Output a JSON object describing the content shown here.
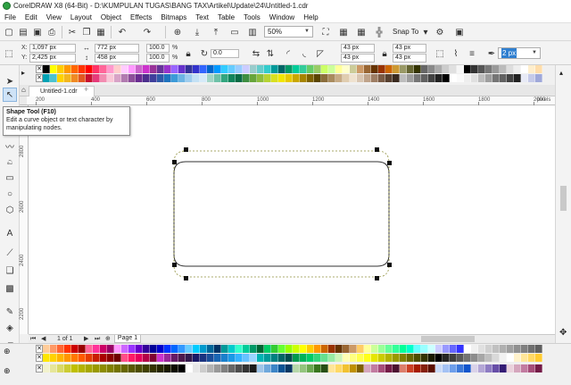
{
  "window": {
    "title": "CorelDRAW X8 (64-Bit) - D:\\KUMPULAN TUGAS\\BANG TAX\\Artikel\\Update\\24\\Untitled-1.cdr"
  },
  "menu": [
    "File",
    "Edit",
    "View",
    "Layout",
    "Object",
    "Effects",
    "Bitmaps",
    "Text",
    "Table",
    "Tools",
    "Window",
    "Help"
  ],
  "toolbar": {
    "zoom": "50%",
    "snap_label": "Snap To"
  },
  "property_bar": {
    "x_label": "X:",
    "x_value": "1,097 px",
    "y_label": "Y:",
    "y_value": "2,425 px",
    "width_value": "772 px",
    "height_value": "458 px",
    "scale_x": "100.0",
    "scale_y": "100.0",
    "pct": "%",
    "rotation": "0.0",
    "corner_tl": "43 px",
    "corner_tr": "43 px",
    "corner_bl": "43 px",
    "corner_br": "43 px",
    "outline_width": "2 px"
  },
  "document": {
    "tab_label": "Untitled-1.cdr",
    "page_counter": "1 of 1",
    "page_tab": "Page 1"
  },
  "ruler": {
    "h_labels": [
      "200",
      "400",
      "600",
      "800",
      "1000",
      "1200",
      "1400",
      "1600",
      "1800",
      "2000"
    ],
    "h_unit": "pixels",
    "v_labels": [
      "2800",
      "2600",
      "2400",
      "2200"
    ]
  },
  "tooltip": {
    "title": "Shape Tool (F10)",
    "description": "Edit a curve object or text character by manipulating nodes."
  },
  "colors": {
    "accent": "#2f7fd0",
    "palette_top_1": [
      "#ffffff",
      "#000000",
      "#ffff00",
      "#ffcc00",
      "#ff9900",
      "#ff6600",
      "#ff3300",
      "#ff0000",
      "#ff3366",
      "#ff6699",
      "#ff99cc",
      "#ffcccc",
      "#ffccff",
      "#ff99ff",
      "#cc66cc",
      "#cc33cc",
      "#993399",
      "#663399",
      "#9933cc",
      "#9966ff",
      "#6633cc",
      "#333399",
      "#3333cc",
      "#3366ff",
      "#0066cc",
      "#0099ff",
      "#33ccff",
      "#66ccff",
      "#99ccff",
      "#ccccff",
      "#99cccc",
      "#66cccc",
      "#33cccc",
      "#009999",
      "#006666",
      "#009966",
      "#00cc99",
      "#33cc99",
      "#66cc66",
      "#99cc66",
      "#ccff66",
      "#ccff99",
      "#ffff99",
      "#ffffcc",
      "#cccc99",
      "#cc9966",
      "#996633",
      "#663300",
      "#993300",
      "#cc6600",
      "#cc9933",
      "#999966",
      "#666633",
      "#333300",
      "#666666",
      "#888888",
      "#aaaaaa",
      "#cccccc",
      "#e0e0e0",
      "#f5f5f5",
      "#000000",
      "#333333",
      "#555555",
      "#777777",
      "#999999",
      "#bbbbbb",
      "#dddddd",
      "#eeeeee",
      "#ffffff",
      "#ffeecc",
      "#ffddaa"
    ],
    "palette_top_2": [
      "#ffffff",
      "#00a2b4",
      "#4cc2d0",
      "#ffd200",
      "#f3b61f",
      "#f08a24",
      "#e25822",
      "#c8102e",
      "#e63b7a",
      "#f28cb1",
      "#f9c6d7",
      "#d8a3c7",
      "#b17bb0",
      "#8e4f9b",
      "#6a2c91",
      "#4b2f8c",
      "#3f3f9c",
      "#2e5aa8",
      "#1e73be",
      "#3c9ad8",
      "#6cb4e4",
      "#9ecdee",
      "#c3e1f5",
      "#d6eaf8",
      "#a2d5c6",
      "#6ec1a8",
      "#33a67f",
      "#12855c",
      "#0a6b45",
      "#3e8e41",
      "#67a53b",
      "#8dbd3e",
      "#b5d334",
      "#d9e021",
      "#f2e600",
      "#e8c900",
      "#c9a700",
      "#a68400",
      "#7e6200",
      "#5a4500",
      "#8a6d3b",
      "#a98b5e",
      "#c7ab85",
      "#e0cdb0",
      "#efe2cf",
      "#d9c6b2",
      "#bfa38a",
      "#9e7e64",
      "#7a5b45",
      "#57402f",
      "#3a2a1f",
      "#bdbdbd",
      "#9e9e9e",
      "#757575",
      "#616161",
      "#424242",
      "#212121",
      "#000000",
      "#ffffff",
      "#fafafa",
      "#eeeeee",
      "#e0e0e0",
      "#bdbdbd",
      "#9e9e9e",
      "#757575",
      "#616161",
      "#424242",
      "#212121",
      "#e8eaf6",
      "#c5cae9",
      "#9fa8da"
    ],
    "palette_bottom_1": [
      "#ffffff",
      "#ffcc99",
      "#ff9966",
      "#ff6633",
      "#ff3300",
      "#cc0000",
      "#990000",
      "#ff6699",
      "#ff3399",
      "#cc0066",
      "#990066",
      "#ff99ff",
      "#cc66ff",
      "#9933ff",
      "#6600cc",
      "#330099",
      "#000099",
      "#0000cc",
      "#0033ff",
      "#0066ff",
      "#3399ff",
      "#66ccff",
      "#00ccff",
      "#0099cc",
      "#006699",
      "#003366",
      "#009999",
      "#00cccc",
      "#33ffcc",
      "#00cc99",
      "#009966",
      "#006633",
      "#00cc66",
      "#33cc33",
      "#66ff33",
      "#99ff00",
      "#ccff00",
      "#ffff00",
      "#ffcc00",
      "#ff9900",
      "#cc6600",
      "#993300",
      "#663300",
      "#996633",
      "#cc9966",
      "#ffcc66",
      "#ffff99",
      "#ccff99",
      "#99ff99",
      "#66ff99",
      "#33ff99",
      "#00ff99",
      "#00ffcc",
      "#66ffff",
      "#99ffff",
      "#ccffff",
      "#ccccff",
      "#9999ff",
      "#6666ff",
      "#3333ff",
      "#ffffff",
      "#f0f0f0",
      "#e0e0e0",
      "#d0d0d0",
      "#c0c0c0",
      "#b0b0b0",
      "#a0a0a0",
      "#909090",
      "#808080",
      "#707070",
      "#606060"
    ],
    "palette_bottom_2": [
      "#ffffff",
      "#ffe600",
      "#ffd200",
      "#ffb400",
      "#ff9600",
      "#ff7800",
      "#ff5a00",
      "#e63c00",
      "#c81e00",
      "#aa0000",
      "#8c0000",
      "#6e0000",
      "#ff4d88",
      "#ff1a66",
      "#e6005c",
      "#b30047",
      "#800033",
      "#cc33cc",
      "#992699",
      "#661a66",
      "#4d194d",
      "#331a4d",
      "#1a1a66",
      "#1a3380",
      "#1a4d99",
      "#1a66b3",
      "#1a80cc",
      "#1a99e6",
      "#33b3ff",
      "#66c2ff",
      "#99d6ff",
      "#00b3b3",
      "#009999",
      "#008080",
      "#006666",
      "#004d4d",
      "#00994d",
      "#00b359",
      "#00cc66",
      "#33d67a",
      "#66e08f",
      "#99eba3",
      "#ccf5b8",
      "#ffffb3",
      "#ffff80",
      "#ffff4d",
      "#ffff1a",
      "#e6e600",
      "#cccc00",
      "#b3b300",
      "#999900",
      "#808000",
      "#666600",
      "#4d4d00",
      "#333300",
      "#1a1a00",
      "#000000",
      "#262626",
      "#404040",
      "#595959",
      "#737373",
      "#8c8c8c",
      "#a6a6a6",
      "#bfbfbf",
      "#d9d9d9",
      "#f2f2f2",
      "#ffffff",
      "#fff2cc",
      "#ffe699",
      "#ffd966",
      "#ffcc33"
    ],
    "palette_bottom_3": [
      "#ffffff",
      "#f2f2cc",
      "#e6e699",
      "#d9d966",
      "#cccc33",
      "#bfbf00",
      "#b3b300",
      "#a6a600",
      "#999900",
      "#8c8c00",
      "#808000",
      "#737300",
      "#666600",
      "#595900",
      "#4d4d00",
      "#404000",
      "#333300",
      "#262600",
      "#1a1a00",
      "#0d0d00",
      "#000000",
      "#ffffff",
      "#e6e6e6",
      "#cccccc",
      "#b3b3b3",
      "#999999",
      "#808080",
      "#666666",
      "#4d4d4d",
      "#333333",
      "#1a1a1a",
      "#9fc5e8",
      "#6fa8dc",
      "#3d85c6",
      "#0b5394",
      "#073763",
      "#b6d7a8",
      "#93c47d",
      "#6aa84f",
      "#38761d",
      "#274e13",
      "#ffe599",
      "#ffd966",
      "#f1c232",
      "#bf9000",
      "#7f6000",
      "#d5a6bd",
      "#c27ba0",
      "#a64d79",
      "#741b47",
      "#4c1130",
      "#dd7e6b",
      "#cc4125",
      "#a61c00",
      "#85200c",
      "#5b0f00",
      "#c9daf8",
      "#a4c2f4",
      "#6d9eeb",
      "#3c78d8",
      "#1155cc",
      "#d9d2e9",
      "#b4a7d6",
      "#8e7cc3",
      "#674ea7",
      "#351c75",
      "#ead1dc",
      "#d5a6bd",
      "#c27ba0",
      "#a64d79",
      "#741b47"
    ]
  }
}
